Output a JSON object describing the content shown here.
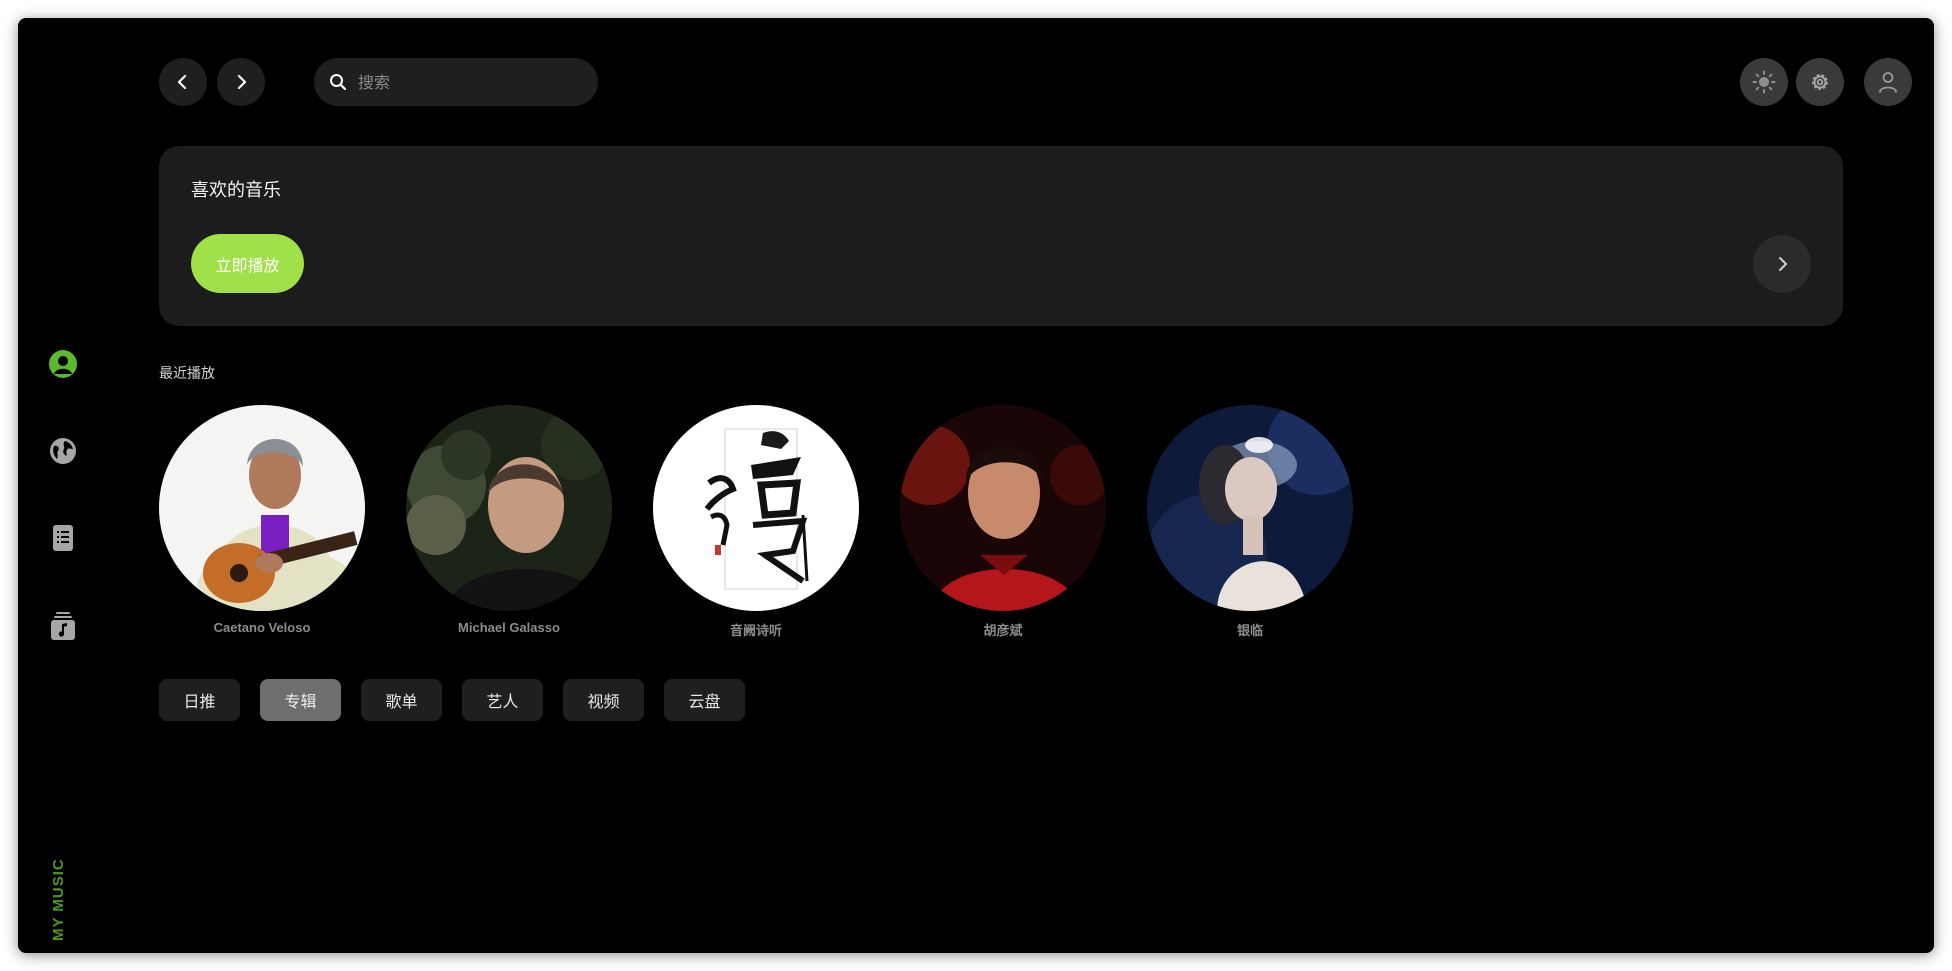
{
  "sidebar": {
    "items": [
      {
        "icon": "user-circle-icon",
        "active": true
      },
      {
        "icon": "globe-icon",
        "active": false
      },
      {
        "icon": "list-book-icon",
        "active": false
      },
      {
        "icon": "music-library-icon",
        "active": false
      }
    ],
    "brand": "MY MUSIC"
  },
  "topbar": {
    "search_placeholder": "搜索",
    "back_icon": "chevron-left-icon",
    "forward_icon": "chevron-right-icon",
    "theme_icon": "sun-icon",
    "settings_icon": "gear-icon",
    "avatar_icon": "user-icon"
  },
  "favorites": {
    "title": "喜欢的音乐",
    "play_label": "立即播放"
  },
  "recent": {
    "title": "最近播放",
    "artists": [
      {
        "name": "Caetano Veloso"
      },
      {
        "name": "Michael Galasso"
      },
      {
        "name": "音阙诗听"
      },
      {
        "name": "胡彦斌"
      },
      {
        "name": "银临"
      }
    ]
  },
  "tabs": [
    {
      "label": "日推",
      "active": false
    },
    {
      "label": "专辑",
      "active": true
    },
    {
      "label": "歌单",
      "active": false
    },
    {
      "label": "艺人",
      "active": false
    },
    {
      "label": "视频",
      "active": false
    },
    {
      "label": "云盘",
      "active": false
    }
  ],
  "colors": {
    "accent": "#a0e048",
    "brand": "#4d9a1e",
    "sidebar_active": "#5cb82e",
    "sidebar_inactive": "#a6a6a6"
  }
}
